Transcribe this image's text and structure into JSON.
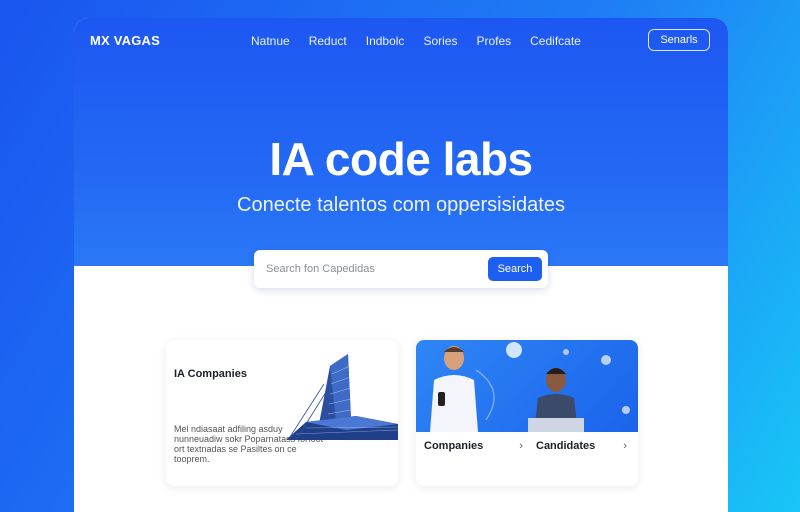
{
  "nav": {
    "logo": "MX VAGAS",
    "links": [
      "Natnue",
      "Reduct",
      "Indbolc",
      "Sories",
      "Profes",
      "Cedifcate"
    ],
    "button": "Senarls"
  },
  "hero": {
    "title": "IA code labs",
    "subtitle": "Conecte talentos com oppersisidates"
  },
  "search": {
    "placeholder": "Search fon Capedidas",
    "button": "Search"
  },
  "cards": {
    "left": {
      "title": "IA Companies",
      "body": "Mel ndiasaat adfiling asduy nunneuadiw sokr Poparnatass forfoot ort textnadas se Pasiltes on ce tooprem."
    },
    "right": {
      "companies": "Companies",
      "candidates": "Candidates"
    }
  },
  "colors": {
    "accent": "#1d5ff0",
    "hero_top": "#1d57f2",
    "background_end": "#18c6f7"
  }
}
